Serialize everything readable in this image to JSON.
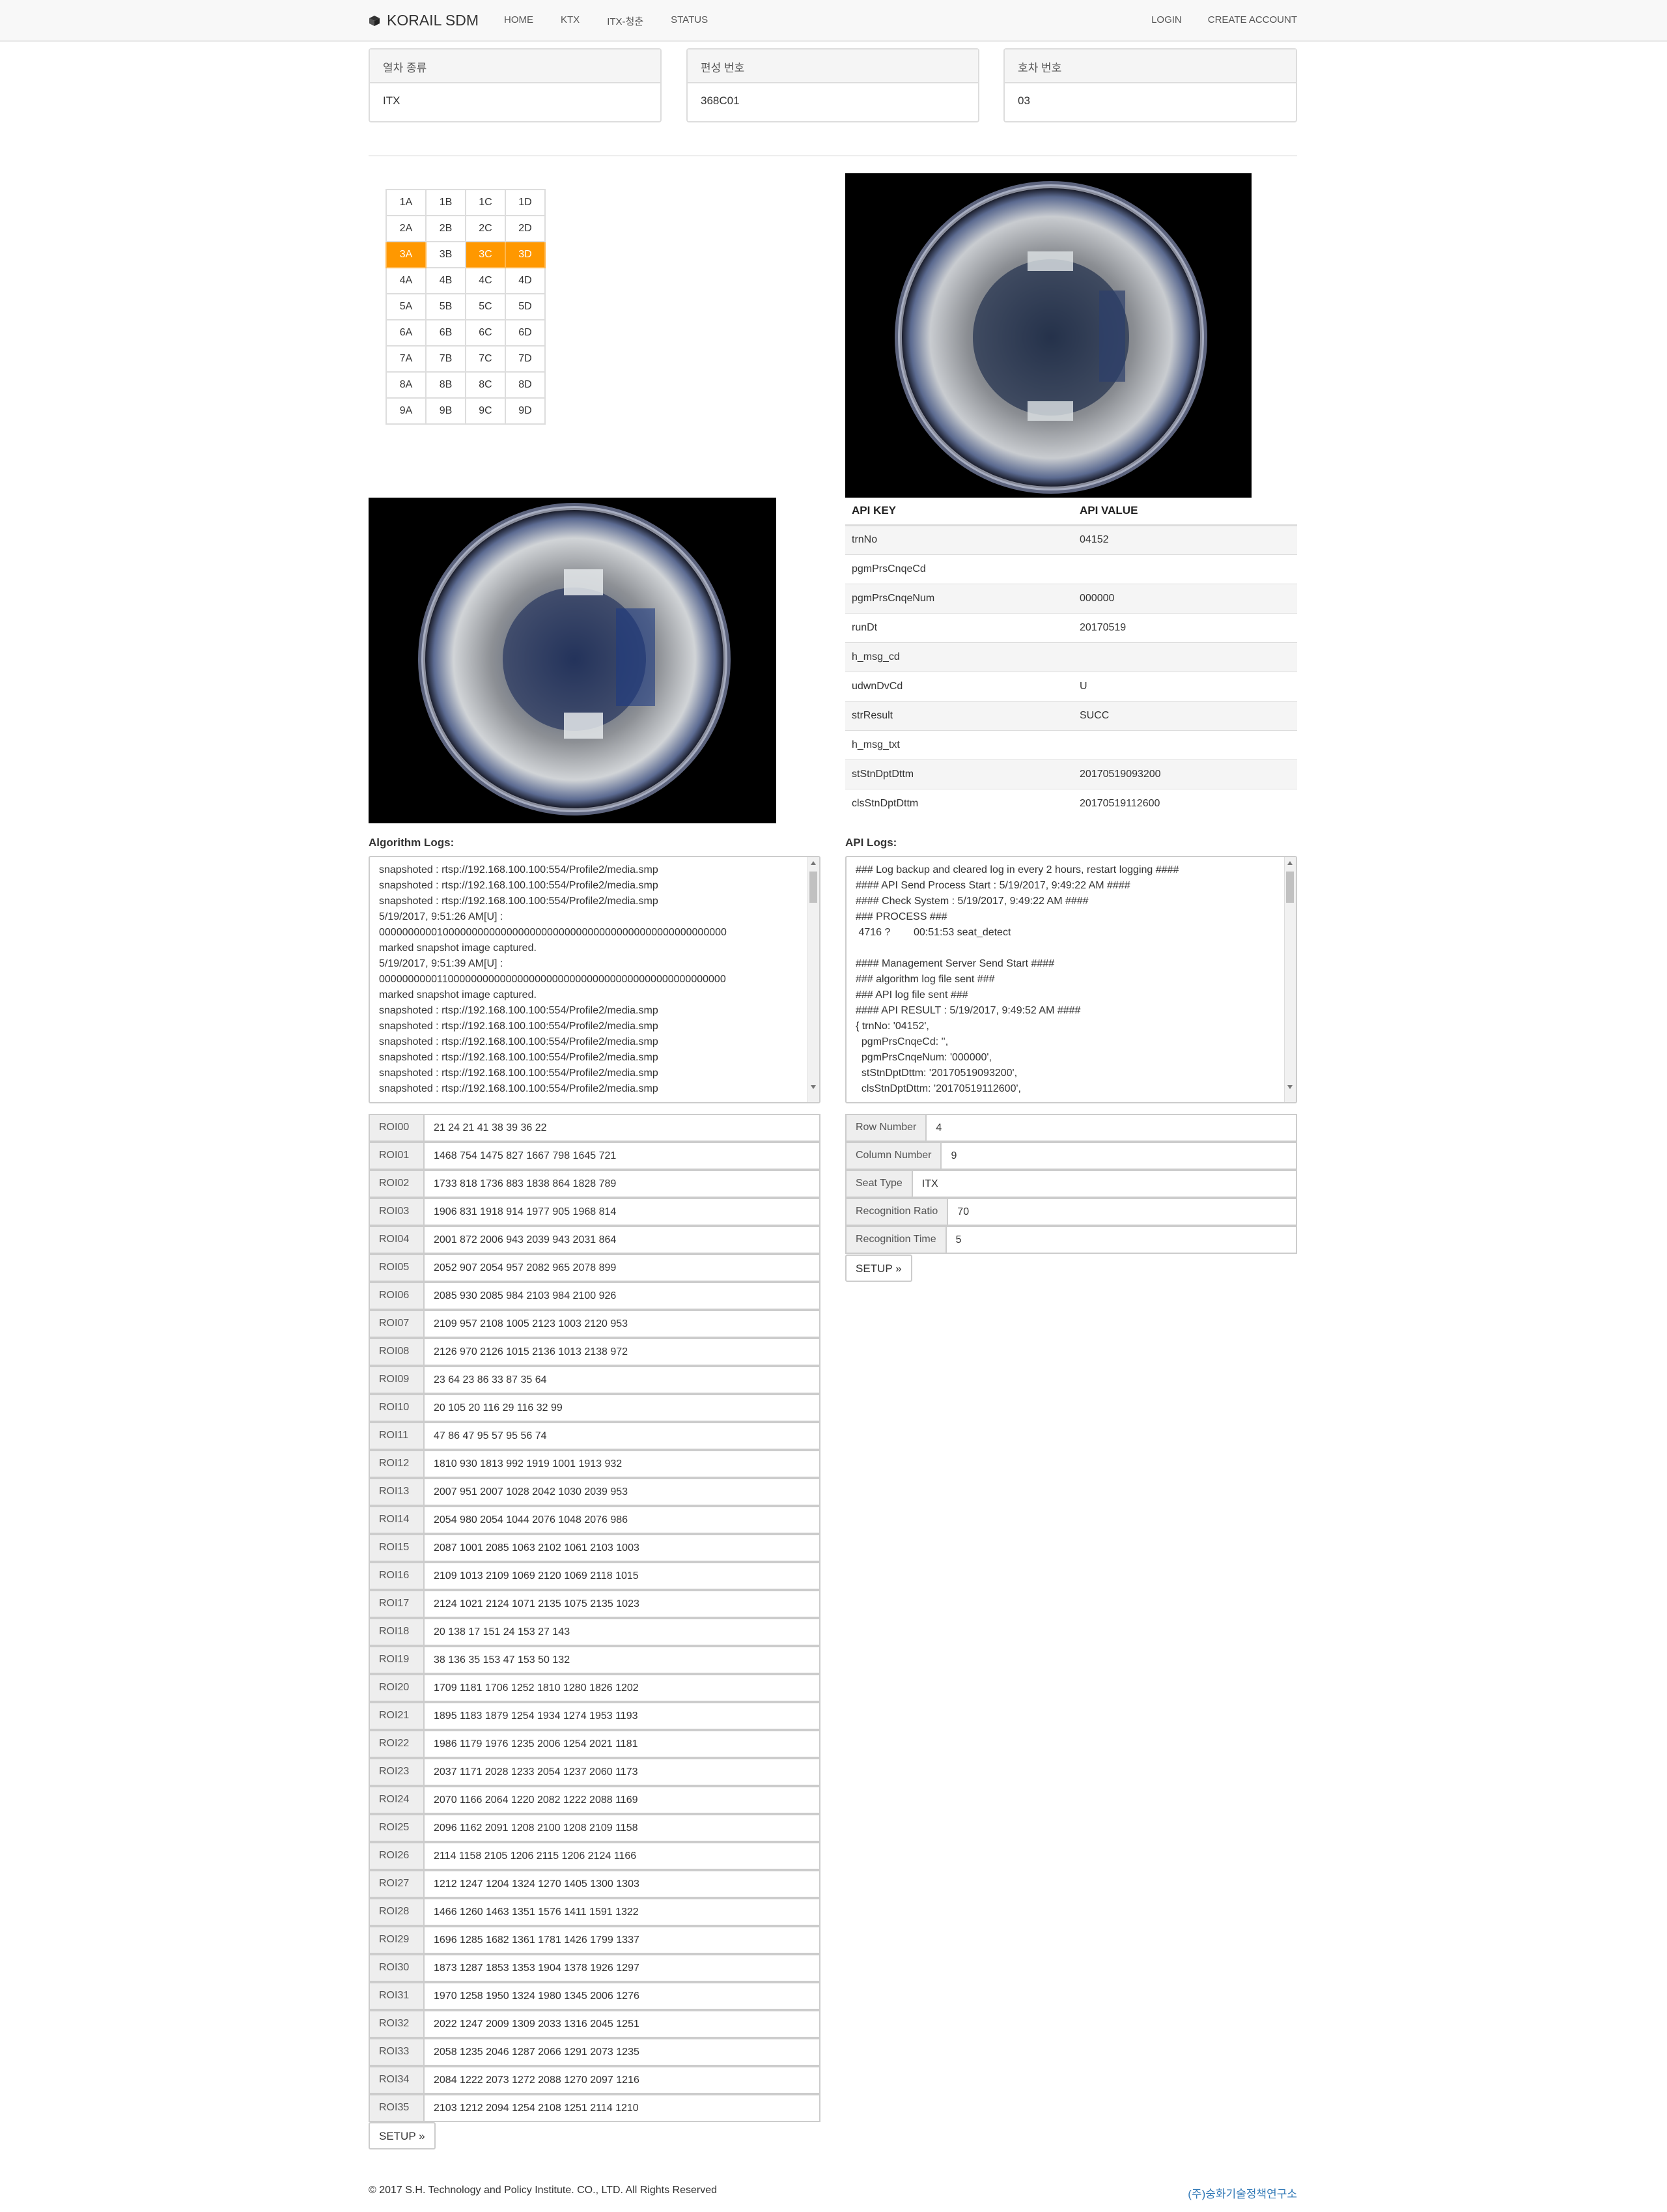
{
  "navbar": {
    "brand": "KORAIL SDM",
    "links": [
      "HOME",
      "KTX",
      "ITX-청춘",
      "STATUS"
    ],
    "login": "LOGIN",
    "create_account": "CREATE ACCOUNT"
  },
  "panels": [
    {
      "heading": "열차 종류",
      "value": "ITX"
    },
    {
      "heading": "편성 번호",
      "value": "368C01"
    },
    {
      "heading": "호차 번호",
      "value": "03"
    }
  ],
  "seats": {
    "rows": [
      [
        "1A",
        "1B",
        "1C",
        "1D"
      ],
      [
        "2A",
        "2B",
        "2C",
        "2D"
      ],
      [
        "3A",
        "3B",
        "3C",
        "3D"
      ],
      [
        "4A",
        "4B",
        "4C",
        "4D"
      ],
      [
        "5A",
        "5B",
        "5C",
        "5D"
      ],
      [
        "6A",
        "6B",
        "6C",
        "6D"
      ],
      [
        "7A",
        "7B",
        "7C",
        "7D"
      ],
      [
        "8A",
        "8B",
        "8C",
        "8D"
      ],
      [
        "9A",
        "9B",
        "9C",
        "9D"
      ]
    ],
    "selected": [
      "3A",
      "3C",
      "3D"
    ],
    "selected_color": "#ff9800"
  },
  "api_table": {
    "key_header": "API KEY",
    "value_header": "API VALUE",
    "rows": [
      {
        "key": "trnNo",
        "value": "04152"
      },
      {
        "key": "pgmPrsCnqeCd",
        "value": ""
      },
      {
        "key": "pgmPrsCnqeNum",
        "value": "000000"
      },
      {
        "key": "runDt",
        "value": "20170519"
      },
      {
        "key": "h_msg_cd",
        "value": ""
      },
      {
        "key": "udwnDvCd",
        "value": "U"
      },
      {
        "key": "strResult",
        "value": "SUCC"
      },
      {
        "key": "h_msg_txt",
        "value": ""
      },
      {
        "key": "stStnDptDttm",
        "value": "20170519093200"
      },
      {
        "key": "clsStnDptDttm",
        "value": "20170519112600"
      }
    ]
  },
  "algorithm_logs": {
    "label": "Algorithm Logs:",
    "lines": [
      "snapshoted : rtsp://192.168.100.100:554/Profile2/media.smp",
      "snapshoted : rtsp://192.168.100.100:554/Profile2/media.smp",
      "snapshoted : rtsp://192.168.100.100:554/Profile2/media.smp",
      "5/19/2017, 9:51:26 AM[U] :",
      "000000000010000000000000000000000000000000000000000000000000",
      "marked snapshot image captured.",
      "5/19/2017, 9:51:39 AM[U] :",
      "000000000011000000000000000000000000000000000000000000000000",
      "marked snapshot image captured.",
      "snapshoted : rtsp://192.168.100.100:554/Profile2/media.smp",
      "snapshoted : rtsp://192.168.100.100:554/Profile2/media.smp",
      "snapshoted : rtsp://192.168.100.100:554/Profile2/media.smp",
      "snapshoted : rtsp://192.168.100.100:554/Profile2/media.smp",
      "snapshoted : rtsp://192.168.100.100:554/Profile2/media.smp",
      "snapshoted : rtsp://192.168.100.100:554/Profile2/media.smp"
    ]
  },
  "api_logs": {
    "label": "API Logs:",
    "lines": [
      "### Log backup and cleared log in every 2 hours, restart logging ####",
      "#### API Send Process Start : 5/19/2017, 9:49:22 AM ####",
      "#### Check System : 5/19/2017, 9:49:22 AM ####",
      "### PROCESS ###",
      " 4716 ?        00:51:53 seat_detect",
      "",
      "#### Management Server Send Start ####",
      "### algorithm log file sent ###",
      "### API log file sent ###",
      "#### API RESULT : 5/19/2017, 9:49:52 AM ####",
      "{ trnNo: '04152',",
      "  pgmPrsCnqeCd: '',",
      "  pgmPrsCnqeNum: '000000',",
      "  stStnDptDttm: '20170519093200',",
      "  clsStnDptDttm: '20170519112600',"
    ]
  },
  "rois": [
    {
      "key": "ROI00",
      "value": "21 24 21 41 38 39 36 22"
    },
    {
      "key": "ROI01",
      "value": "1468 754 1475 827 1667 798 1645 721"
    },
    {
      "key": "ROI02",
      "value": "1733 818 1736 883 1838 864 1828 789"
    },
    {
      "key": "ROI03",
      "value": "1906 831 1918 914 1977 905 1968 814"
    },
    {
      "key": "ROI04",
      "value": "2001 872 2006 943 2039 943 2031 864"
    },
    {
      "key": "ROI05",
      "value": "2052 907 2054 957 2082 965 2078 899"
    },
    {
      "key": "ROI06",
      "value": "2085 930 2085 984 2103 984 2100 926"
    },
    {
      "key": "ROI07",
      "value": "2109 957 2108 1005 2123 1003 2120 953"
    },
    {
      "key": "ROI08",
      "value": "2126 970 2126 1015 2136 1013 2138 972"
    },
    {
      "key": "ROI09",
      "value": "23 64 23 86 33 87 35 64"
    },
    {
      "key": "ROI10",
      "value": "20 105 20 116 29 116 32 99"
    },
    {
      "key": "ROI11",
      "value": "47 86 47 95 57 95 56 74"
    },
    {
      "key": "ROI12",
      "value": "1810 930 1813 992 1919 1001 1913 932"
    },
    {
      "key": "ROI13",
      "value": "2007 951 2007 1028 2042 1030 2039 953"
    },
    {
      "key": "ROI14",
      "value": "2054 980 2054 1044 2076 1048 2076 986"
    },
    {
      "key": "ROI15",
      "value": "2087 1001 2085 1063 2102 1061 2103 1003"
    },
    {
      "key": "ROI16",
      "value": "2109 1013 2109 1069 2120 1069 2118 1015"
    },
    {
      "key": "ROI17",
      "value": "2124 1021 2124 1071 2135 1075 2135 1023"
    },
    {
      "key": "ROI18",
      "value": "20 138 17 151 24 153 27 143"
    },
    {
      "key": "ROI19",
      "value": "38 136 35 153 47 153 50 132"
    },
    {
      "key": "ROI20",
      "value": "1709 1181 1706 1252 1810 1280 1826 1202"
    },
    {
      "key": "ROI21",
      "value": "1895 1183 1879 1254 1934 1274 1953 1193"
    },
    {
      "key": "ROI22",
      "value": "1986 1179 1976 1235 2006 1254 2021 1181"
    },
    {
      "key": "ROI23",
      "value": "2037 1171 2028 1233 2054 1237 2060 1173"
    },
    {
      "key": "ROI24",
      "value": "2070 1166 2064 1220 2082 1222 2088 1169"
    },
    {
      "key": "ROI25",
      "value": "2096 1162 2091 1208 2100 1208 2109 1158"
    },
    {
      "key": "ROI26",
      "value": "2114 1158 2105 1206 2115 1206 2124 1166"
    },
    {
      "key": "ROI27",
      "value": "1212 1247 1204 1324 1270 1405 1300 1303"
    },
    {
      "key": "ROI28",
      "value": "1466 1260 1463 1351 1576 1411 1591 1322"
    },
    {
      "key": "ROI29",
      "value": "1696 1285 1682 1361 1781 1426 1799 1337"
    },
    {
      "key": "ROI30",
      "value": "1873 1287 1853 1353 1904 1378 1926 1297"
    },
    {
      "key": "ROI31",
      "value": "1970 1258 1950 1324 1980 1345 2006 1276"
    },
    {
      "key": "ROI32",
      "value": "2022 1247 2009 1309 2033 1316 2045 1251"
    },
    {
      "key": "ROI33",
      "value": "2058 1235 2046 1287 2066 1291 2073 1235"
    },
    {
      "key": "ROI34",
      "value": "2084 1222 2073 1272 2088 1270 2097 1216"
    },
    {
      "key": "ROI35",
      "value": "2103 1212 2094 1254 2108 1251 2114 1210"
    }
  ],
  "roi_setup_label": "SETUP »",
  "settings": [
    {
      "key": "Row Number",
      "value": "4"
    },
    {
      "key": "Column Number",
      "value": "9"
    },
    {
      "key": "Seat Type",
      "value": "ITX"
    },
    {
      "key": "Recognition Ratio",
      "value": "70"
    },
    {
      "key": "Recognition Time",
      "value": "5"
    }
  ],
  "settings_setup_label": "SETUP »",
  "footer": {
    "copyright": "© 2017 S.H. Technology and Policy Institute. CO., LTD. All Rights Reserved",
    "link": "(주)숭화기술정책연구소"
  }
}
